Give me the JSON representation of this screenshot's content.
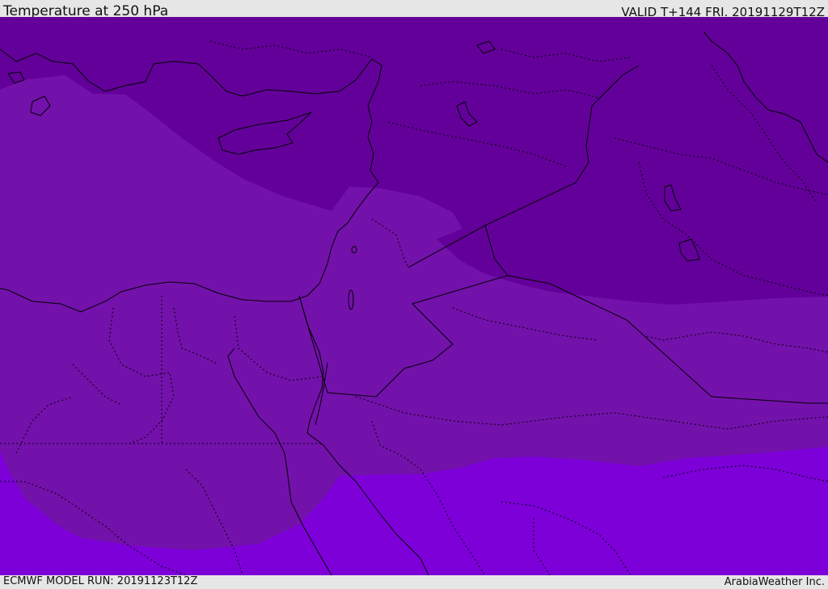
{
  "header": {
    "title": "Temperature at 250 hPa",
    "valid": "VALID T+144 FRI. 20191129T12Z"
  },
  "footer": {
    "model_run": "ECMWF MODEL RUN: 20191123T12Z",
    "credit": "ArabiaWeather Inc."
  },
  "map": {
    "region": "Eastern Mediterranean and Middle East",
    "bands": [
      {
        "zone": "north-cold",
        "color": "#63009a"
      },
      {
        "zone": "middle",
        "color": "#7311ab"
      },
      {
        "zone": "south-warm",
        "color": "#7d00d9"
      }
    ],
    "coastline_color": "#000000",
    "border_style": "dotted"
  }
}
